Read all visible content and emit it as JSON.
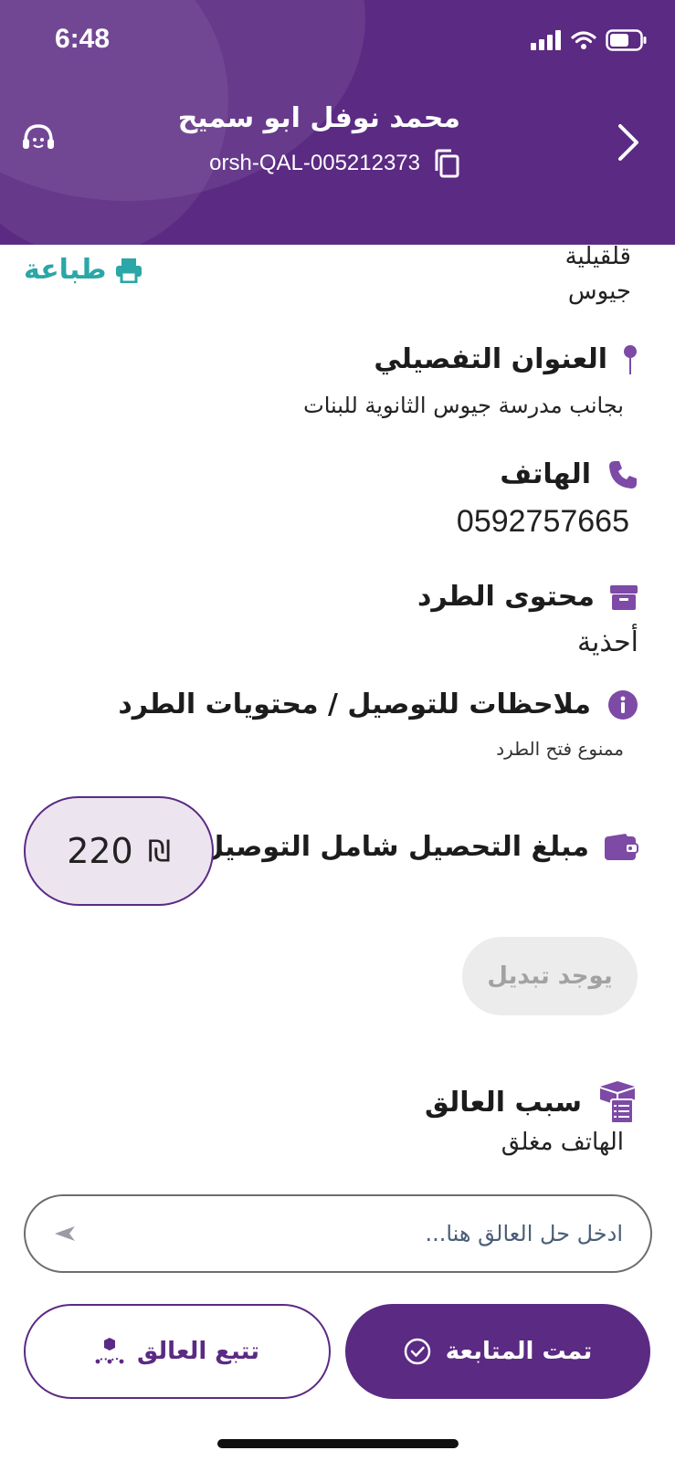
{
  "status_bar": {
    "time": "6:48"
  },
  "header": {
    "customer_name": "محمد نوفل ابو سميح",
    "reference_code": "orsh-QAL-005212373"
  },
  "print": {
    "label": "طباعة"
  },
  "city": {
    "line1": "قلقيلية",
    "line2": "جيوس"
  },
  "address": {
    "title": "العنوان التفصيلي",
    "value": "بجانب مدرسة جيوس الثانوية للبنات"
  },
  "phone": {
    "title": "الهاتف",
    "value": "0592757665"
  },
  "content": {
    "title": "محتوى الطرد",
    "value": "أحذية"
  },
  "notes": {
    "title": "ملاحظات للتوصيل / محتويات الطرد",
    "value": "ممنوع فتح الطرد"
  },
  "amount": {
    "title": "مبلغ التحصيل شامل التوصيل",
    "value": "220",
    "currency": "₪"
  },
  "exchange": {
    "label": "يوجد تبديل"
  },
  "hold": {
    "title": "سبب العالق",
    "value": "الهاتف مغلق"
  },
  "solution_input": {
    "placeholder": "ادخل حل العالق هنا..."
  },
  "actions": {
    "track_label": "تتبع العالق",
    "done_label": "تمت المتابعة"
  },
  "colors": {
    "primary": "#5b2a83",
    "teal": "#2aa7a6",
    "muted_pill": "#ececec"
  }
}
